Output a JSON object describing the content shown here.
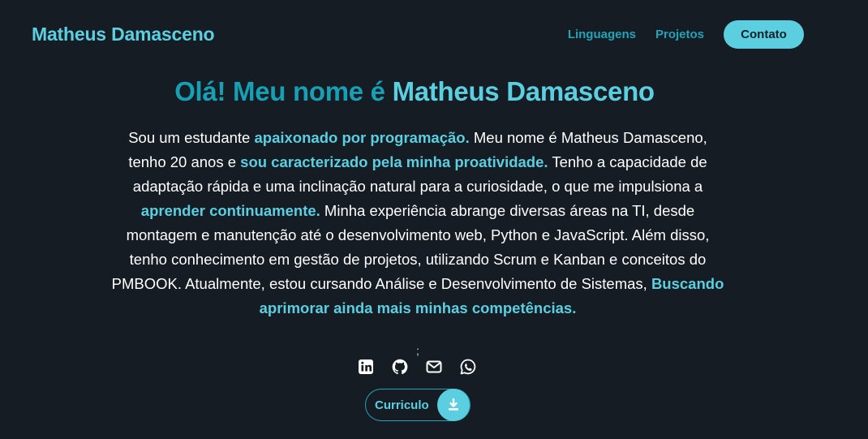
{
  "header": {
    "brand": "Matheus Damasceno",
    "nav": {
      "languages": "Linguagens",
      "projects": "Projetos",
      "contact": "Contato"
    }
  },
  "hero": {
    "title_prefix": "Olá! Meu nome é ",
    "title_name": "Matheus Damasceno",
    "bio": {
      "p1": "Sou um estudante ",
      "h1": "apaixonado por programação.",
      "p2": " Meu nome é Matheus Damasceno, tenho 20 anos e ",
      "h2": "sou caracterizado pela minha proatividade.",
      "p3": " Tenho a capacidade de adaptação rápida e uma inclinação natural para a curiosidade, o que me impulsiona a ",
      "h3": "aprender continuamente.",
      "p4": " Minha experiência abrange diversas áreas na TI, desde montagem e manutenção até o desenvolvimento web, Python e JavaScript. Além disso, tenho conhecimento em gestão de projetos, utilizando Scrum e Kanban e conceitos do PMBOOK. Atualmente, estou cursando Análise e Desenvolvimento de Sistemas, ",
      "h4": "Buscando aprimorar ainda mais minhas competências."
    },
    "stray_mark": ";"
  },
  "social": {
    "icons": [
      "linkedin-icon",
      "github-icon",
      "mail-icon",
      "whatsapp-icon"
    ]
  },
  "resume": {
    "label": "Curriculo",
    "icon": "download-icon"
  },
  "colors": {
    "background": "#161c24",
    "accent": "#5bcfe0",
    "accent_dark": "#17a0b4",
    "text": "#ffffff"
  }
}
